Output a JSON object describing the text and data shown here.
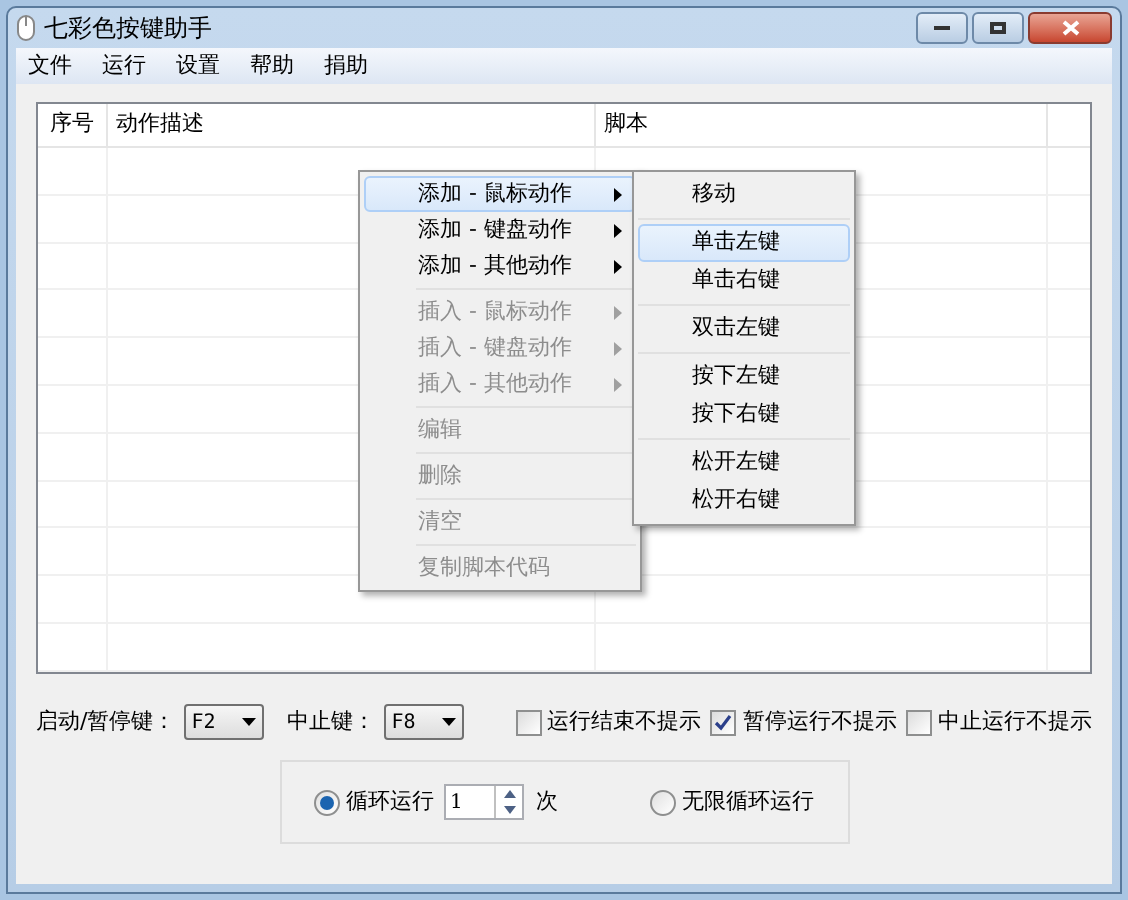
{
  "window": {
    "title": "七彩色按键助手"
  },
  "menu_bar": [
    {
      "label": "文件"
    },
    {
      "label": "运行"
    },
    {
      "label": "设置"
    },
    {
      "label": "帮助"
    },
    {
      "label": "捐助"
    }
  ],
  "table": {
    "columns": [
      {
        "label": "序号"
      },
      {
        "label": "动作描述"
      },
      {
        "label": "脚本"
      }
    ]
  },
  "context_menu": {
    "groups": [
      [
        {
          "label": "添加 - 鼠标动作",
          "submenu": true,
          "disabled": false,
          "selected": true
        },
        {
          "label": "添加 - 键盘动作",
          "submenu": true,
          "disabled": false,
          "selected": false
        },
        {
          "label": "添加 - 其他动作",
          "submenu": true,
          "disabled": false,
          "selected": false
        }
      ],
      [
        {
          "label": "插入 - 鼠标动作",
          "submenu": true,
          "disabled": true,
          "selected": false
        },
        {
          "label": "插入 - 键盘动作",
          "submenu": true,
          "disabled": true,
          "selected": false
        },
        {
          "label": "插入 - 其他动作",
          "submenu": true,
          "disabled": true,
          "selected": false
        }
      ],
      [
        {
          "label": "编辑",
          "submenu": false,
          "disabled": true,
          "selected": false
        }
      ],
      [
        {
          "label": "删除",
          "submenu": false,
          "disabled": true,
          "selected": false
        }
      ],
      [
        {
          "label": "清空",
          "submenu": false,
          "disabled": true,
          "selected": false
        }
      ],
      [
        {
          "label": "复制脚本代码",
          "submenu": false,
          "disabled": true,
          "selected": false
        }
      ]
    ]
  },
  "submenu": {
    "groups": [
      [
        {
          "label": "移动",
          "selected": false
        }
      ],
      [
        {
          "label": "单击左键",
          "selected": true
        },
        {
          "label": "单击右键",
          "selected": false
        }
      ],
      [
        {
          "label": "双击左键",
          "selected": false
        }
      ],
      [
        {
          "label": "按下左键",
          "selected": false
        },
        {
          "label": "按下右键",
          "selected": false
        }
      ],
      [
        {
          "label": "松开左键",
          "selected": false
        },
        {
          "label": "松开右键",
          "selected": false
        }
      ]
    ]
  },
  "hotkeys": [
    {
      "label": "启动/暂停键：",
      "value": "F2"
    },
    {
      "label": "中止键：",
      "value": "F8"
    }
  ],
  "options": [
    {
      "label": "运行结束不提示",
      "checked": false
    },
    {
      "label": "暂停运行不提示",
      "checked": true
    },
    {
      "label": "中止运行不提示",
      "checked": false
    }
  ],
  "loop": {
    "loop_radio": {
      "label": "循环运行",
      "selected": true
    },
    "count": "1",
    "unit": "次",
    "infinite_radio": {
      "label": "无限循环运行",
      "selected": false
    }
  }
}
